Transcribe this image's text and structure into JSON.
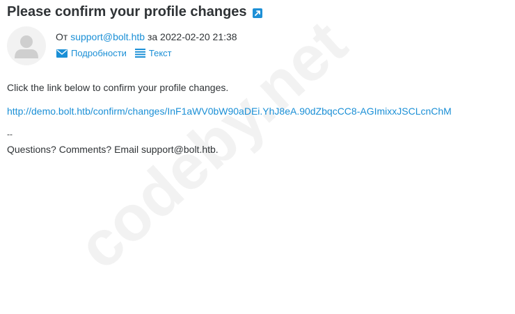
{
  "email": {
    "subject": "Please confirm your profile changes",
    "from_prefix": "От",
    "sender": "support@bolt.htb",
    "date_prefix": "за",
    "datetime": "2022-02-20 21:38",
    "actions": [
      {
        "label": "Подробности",
        "icon": "envelope-icon"
      },
      {
        "label": "Текст",
        "icon": "list-icon"
      }
    ],
    "body": {
      "line1": "Click the link below to confirm your profile changes.",
      "link": "http://demo.bolt.htb/confirm/changes/InF1aWV0bW90aDEi.YhJ8eA.90dZbqcCC8-AGImixxJSCLcnChM",
      "signature_sep": "--",
      "signature": "Questions? Comments? Email support@bolt.htb."
    }
  },
  "watermark": {
    "text": "codeby.net",
    "color": "#f2f2f2"
  },
  "colors": {
    "link": "#1a8fd6",
    "text": "#2f3336",
    "external_icon_bg": "#1e90d6"
  }
}
